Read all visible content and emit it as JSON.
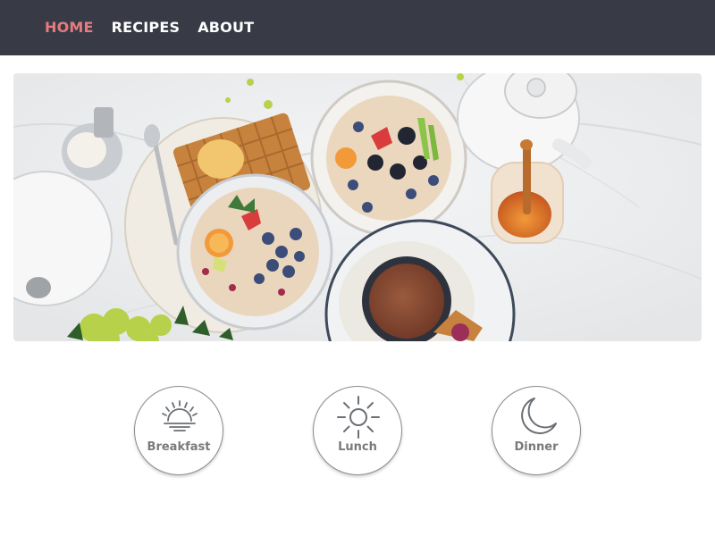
{
  "nav": {
    "items": [
      {
        "label": "HOME",
        "active": true
      },
      {
        "label": "RECIPES",
        "active": false
      },
      {
        "label": "ABOUT",
        "active": false
      }
    ]
  },
  "hero": {
    "image": "breakfast-table-photo"
  },
  "meals": [
    {
      "label": "Breakfast",
      "icon": "sunrise-icon"
    },
    {
      "label": "Lunch",
      "icon": "sun-icon"
    },
    {
      "label": "Dinner",
      "icon": "moon-icon"
    }
  ],
  "colors": {
    "navbar": "#383b46",
    "active_link": "#e77a80",
    "link": "#ffffff",
    "meal_label": "#7a7a7a"
  }
}
